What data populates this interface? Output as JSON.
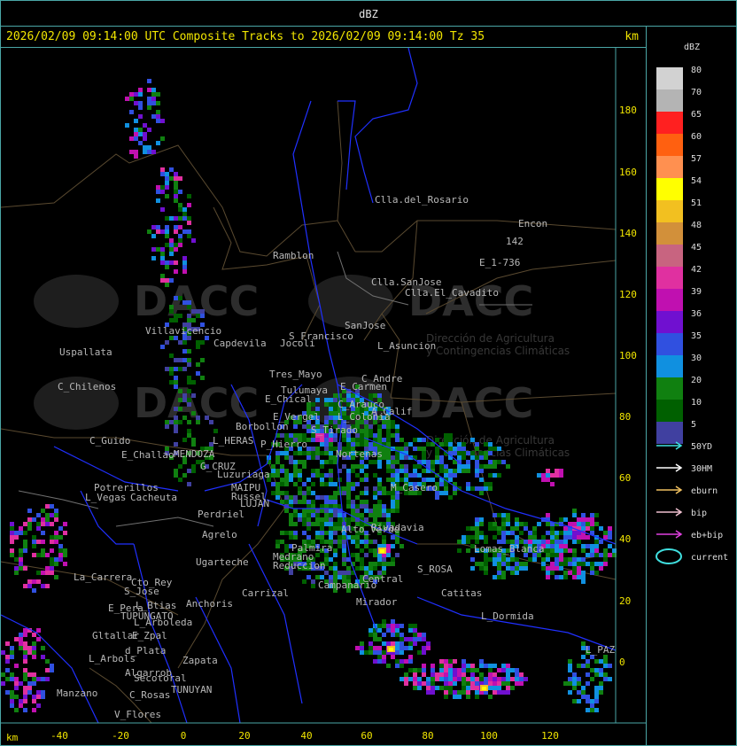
{
  "header": {
    "title": "dBZ"
  },
  "map": {
    "title": "2026/02/09 09:14:00 UTC Composite Tracks to 2026/02/09 09:14:00 Tz 35",
    "unit_right": "km",
    "unit_bottom": "km",
    "x_ticks": [
      "-40",
      "-20",
      "0",
      "20",
      "40",
      "60",
      "80",
      "100",
      "120"
    ],
    "y_ticks": [
      "180",
      "160",
      "140",
      "120",
      "100",
      "80",
      "60",
      "40",
      "20",
      "0"
    ],
    "watermark": {
      "brand": "DACC",
      "subtitle_1": "Dirección de Agricultura",
      "subtitle_2": "y Contingencias Climáticas"
    },
    "places": [
      "Clla.del_Rosario",
      "Encon",
      "142",
      "E_1-736",
      "Ramblon",
      "Clla.SanJose",
      "Clla.El_Cavadito",
      "S_Francisco",
      "SanJose",
      "L_Asuncion",
      "Uspallata",
      "Villavicencio",
      "Capdevila",
      "Jocoli",
      "C_Chilenos",
      "Tres_Mayo",
      "Tulumaya",
      "E_Carmen",
      "C_Andre",
      "E_Chical",
      "C_Arauco",
      "A_Calif",
      "E_Vergel",
      "Borbollon",
      "L_HERAS",
      "P_Hierro",
      "S_Tirado",
      "C_Guido",
      "E_Challao",
      "MENDOZA",
      "G_CRUZ",
      "Luzuriaga",
      "Potrerillos",
      "L_Vegas",
      "Cacheuta",
      "MAIPU",
      "Russel",
      "LUJAN",
      "Perdriel",
      "Agrelo",
      "Ugarteche",
      "La_Carrera",
      "Cto_Rey",
      "S_Jose",
      "Carrizal",
      "E_Pera",
      "L_Btias",
      "Anchoris",
      "TUPUNGATO",
      "L_Arboleda",
      "Gltallar",
      "E_Zpal",
      "L_Arbols",
      "d_Plata",
      "Zapata",
      "Algarrob",
      "Secotoral",
      "TUNUYAN",
      "Manzano",
      "C_Rosas",
      "V_Flores",
      "Catitas",
      "L_Dormida",
      "Lomas_Blanca",
      "L_PAZ",
      "Central",
      "Mirador",
      "Campanario",
      "S_ROSA",
      "Medrano",
      "Reduccion",
      "M_Casero",
      "Nortenas",
      "Alto_Verde",
      "Rivadavia",
      "Palmira",
      "L_Colonia"
    ]
  },
  "legend": {
    "title": "dBZ",
    "levels": [
      {
        "value": "80",
        "color": "#d2d2d2"
      },
      {
        "value": "70",
        "color": "#b4b4b4"
      },
      {
        "value": "65",
        "color": "#ff2020"
      },
      {
        "value": "60",
        "color": "#ff6010"
      },
      {
        "value": "57",
        "color": "#ff9050"
      },
      {
        "value": "54",
        "color": "#ffff00"
      },
      {
        "value": "51",
        "color": "#f2c020"
      },
      {
        "value": "48",
        "color": "#d2903a"
      },
      {
        "value": "45",
        "color": "#c86480"
      },
      {
        "value": "42",
        "color": "#e030a0"
      },
      {
        "value": "39",
        "color": "#c010b0"
      },
      {
        "value": "36",
        "color": "#7010d0"
      },
      {
        "value": "35",
        "color": "#3050e0"
      },
      {
        "value": "30",
        "color": "#1090e0"
      },
      {
        "value": "20",
        "color": "#108010"
      },
      {
        "value": "10",
        "color": "#006000"
      },
      {
        "value": "5",
        "color": "#4040a0"
      }
    ],
    "tracks": [
      {
        "label": "50YD",
        "color": "#40e0e0"
      },
      {
        "label": "30HM",
        "color": "#ffffff"
      },
      {
        "label": "eburn",
        "color": "#f0c060"
      },
      {
        "label": "bip",
        "color": "#f0c0d0"
      },
      {
        "label": "eb+bip",
        "color": "#e040e0"
      },
      {
        "label": "current",
        "color": "#40e0e0"
      }
    ]
  }
}
